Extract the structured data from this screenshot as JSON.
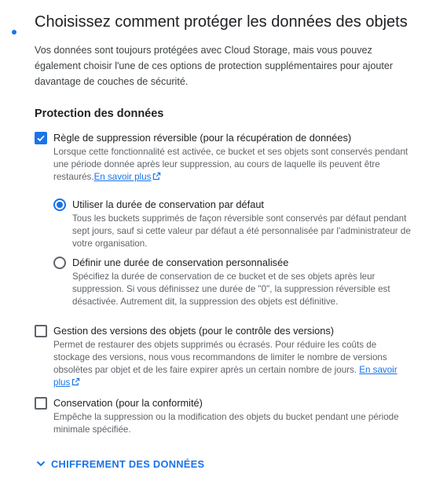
{
  "section": {
    "title": "Choisissez comment protéger les données des objets",
    "intro": "Vos données sont toujours protégées avec Cloud Storage, mais vous pouvez également choisir l'une de ces options de protection supplémentaires pour ajouter davantage de couches de sécurité."
  },
  "protection": {
    "heading": "Protection des données",
    "soft_delete": {
      "label": "Règle de suppression réversible (pour la récupération de données)",
      "checked": true,
      "description": "Lorsque cette fonctionnalité est activée, ce bucket et ses objets sont conservés pendant une période donnée après leur suppression, au cours de laquelle ils peuvent être restaurés.",
      "learn_more": "En savoir plus",
      "retention_options": [
        {
          "label": "Utiliser la durée de conservation par défaut",
          "selected": true,
          "description": "Tous les buckets supprimés de façon réversible sont conservés par défaut pendant sept jours, sauf si cette valeur par défaut a été personnalisée par l'administrateur de votre organisation."
        },
        {
          "label": "Définir une durée de conservation personnalisée",
          "selected": false,
          "description": "Spécifiez la durée de conservation de ce bucket et de ses objets après leur suppression. Si vous définissez une durée de \"0\", la suppression réversible est désactivée. Autrement dit, la suppression des objets est définitive."
        }
      ]
    },
    "versioning": {
      "label": "Gestion des versions des objets (pour le contrôle des versions)",
      "checked": false,
      "description": "Permet de restaurer des objets supprimés ou écrasés. Pour réduire les coûts de stockage des versions, nous vous recommandons de limiter le nombre de versions obsolètes par objet et de les faire expirer après un certain nombre de jours.",
      "learn_more": "En savoir plus"
    },
    "retention": {
      "label": "Conservation (pour la conformité)",
      "checked": false,
      "description": "Empêche la suppression ou la modification des objets du bucket pendant une période minimale spécifiée."
    }
  },
  "encryption": {
    "label": "CHIFFREMENT DES DONNÉES"
  },
  "colors": {
    "accent": "#1a73e8",
    "text": "#202124",
    "secondary_text": "#5f6368"
  }
}
